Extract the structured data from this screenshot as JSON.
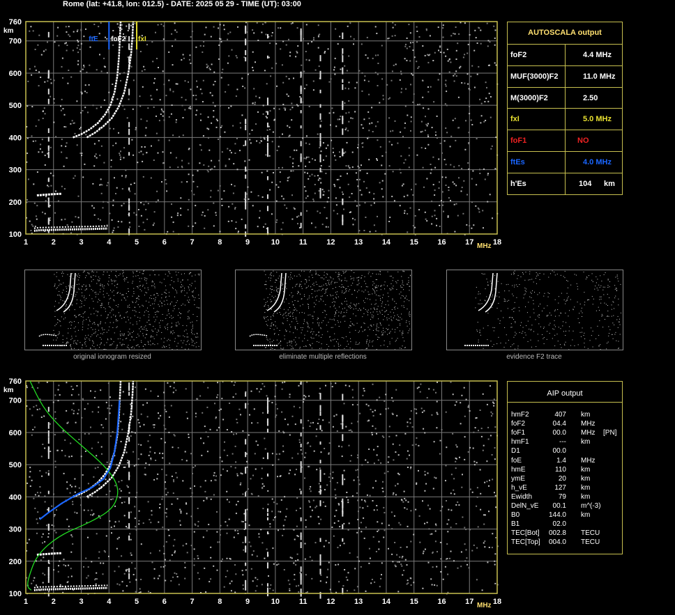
{
  "header": "Rome (lat: +41.8, lon: 012.5) - DATE: 2025 05 29 - TIME (UT): 03:00",
  "colors": {
    "frame": "#c8c050",
    "grid": "#7a7a7a",
    "trace": "#ffffff",
    "profile": "#22dd22",
    "blue": "#1a66ff",
    "yellow": "#e8e030",
    "red": "#ee2222"
  },
  "chart_data": [
    {
      "type": "scatter",
      "name": "ionogram-autoscala",
      "xlabel": "MHz",
      "ylabel": "km",
      "xlim": [
        1,
        18
      ],
      "ylim": [
        100,
        760
      ],
      "xticks": [
        1,
        2,
        3,
        4,
        5,
        6,
        7,
        8,
        9,
        10,
        11,
        12,
        13,
        14,
        15,
        16,
        17,
        18
      ],
      "yticks": [
        100,
        200,
        300,
        400,
        500,
        600,
        700,
        760
      ],
      "grid": true,
      "markers": [
        {
          "label": "ftE",
          "x": 4.0,
          "color": "blue"
        },
        {
          "label": "foF2",
          "x": 4.4,
          "color": "white"
        },
        {
          "label": "fxI",
          "x": 5.0,
          "color": "yellow"
        }
      ],
      "traces": {
        "o_F2": [
          [
            2.7,
            400
          ],
          [
            3.0,
            410
          ],
          [
            3.3,
            425
          ],
          [
            3.6,
            445
          ],
          [
            3.85,
            470
          ],
          [
            4.05,
            500
          ],
          [
            4.2,
            540
          ],
          [
            4.3,
            590
          ],
          [
            4.36,
            650
          ],
          [
            4.4,
            720
          ],
          [
            4.42,
            760
          ]
        ],
        "x_F2": [
          [
            3.2,
            400
          ],
          [
            3.5,
            415
          ],
          [
            3.8,
            435
          ],
          [
            4.1,
            460
          ],
          [
            4.35,
            495
          ],
          [
            4.55,
            540
          ],
          [
            4.7,
            600
          ],
          [
            4.8,
            660
          ],
          [
            4.85,
            720
          ],
          [
            4.87,
            760
          ]
        ],
        "E_layer": [
          [
            1.3,
            110
          ],
          [
            1.5,
            112
          ],
          [
            2.0,
            113
          ],
          [
            2.5,
            114
          ],
          [
            3.0,
            115
          ],
          [
            3.5,
            116
          ],
          [
            3.95,
            117
          ]
        ],
        "Es_second": [
          [
            1.4,
            220
          ],
          [
            1.7,
            222
          ],
          [
            2.0,
            224
          ],
          [
            2.3,
            225
          ]
        ]
      }
    },
    {
      "type": "scatter",
      "name": "ionogram-aip",
      "xlabel": "MHz",
      "ylabel": "km",
      "xlim": [
        1,
        18
      ],
      "ylim": [
        100,
        760
      ],
      "xticks": [
        1,
        2,
        3,
        4,
        5,
        6,
        7,
        8,
        9,
        10,
        11,
        12,
        13,
        14,
        15,
        16,
        17,
        18
      ],
      "yticks": [
        100,
        200,
        300,
        400,
        500,
        600,
        700,
        760
      ],
      "grid": true,
      "profile_curve": [
        [
          1.15,
          760
        ],
        [
          1.6,
          680
        ],
        [
          2.2,
          620
        ],
        [
          3.0,
          560
        ],
        [
          3.8,
          500
        ],
        [
          4.25,
          450
        ],
        [
          4.35,
          407
        ],
        [
          4.1,
          360
        ],
        [
          3.3,
          320
        ],
        [
          2.2,
          280
        ],
        [
          1.4,
          220
        ],
        [
          1.1,
          150
        ],
        [
          1.05,
          120
        ],
        [
          1.2,
          110
        ]
      ],
      "fit_trace": [
        [
          1.5,
          330
        ],
        [
          1.8,
          350
        ],
        [
          2.3,
          380
        ],
        [
          2.9,
          410
        ],
        [
          3.4,
          430
        ],
        [
          3.8,
          455
        ],
        [
          4.05,
          490
        ],
        [
          4.2,
          540
        ],
        [
          4.3,
          600
        ],
        [
          4.35,
          660
        ],
        [
          4.38,
          700
        ]
      ]
    }
  ],
  "autoscala": {
    "title": "AUTOSCALA output",
    "rows": [
      {
        "label": "foF2",
        "value": "4.4 MHz",
        "color": "#ffffff"
      },
      {
        "label": "MUF(3000)F2",
        "value": "11.0 MHz",
        "color": "#ffffff"
      },
      {
        "label": "M(3000)F2",
        "value": "2.50",
        "color": "#ffffff"
      },
      {
        "label": "fxI",
        "value": "5.0 MHz",
        "color": "#e8e030"
      },
      {
        "label": "foF1",
        "value": "NO",
        "color": "#ee2222"
      },
      {
        "label": "ftEs",
        "value": "4.0 MHz",
        "color": "#1a66ff"
      },
      {
        "label": "h'Es",
        "value": "104",
        "unit": "km",
        "color": "#ffffff"
      }
    ]
  },
  "thumbnails": [
    {
      "caption": "original ionogram resized"
    },
    {
      "caption": "eliminate multiple reflections"
    },
    {
      "caption": "evidence F2 trace"
    }
  ],
  "aip": {
    "title": "AIP output",
    "rows": [
      {
        "k": "hmF2",
        "v": "407",
        "u": "km",
        "x": ""
      },
      {
        "k": "foF2",
        "v": "04.4",
        "u": "MHz",
        "x": ""
      },
      {
        "k": "foF1",
        "v": "00.0",
        "u": "MHz",
        "x": "[PN]"
      },
      {
        "k": "hmF1",
        "v": "---",
        "u": "km",
        "x": ""
      },
      {
        "k": "D1",
        "v": "00.0",
        "u": "",
        "x": ""
      },
      {
        "k": "foE",
        "v": "1.4",
        "u": "MHz",
        "x": ""
      },
      {
        "k": "hmE",
        "v": "110",
        "u": "km",
        "x": ""
      },
      {
        "k": "ymE",
        "v": "20",
        "u": "km",
        "x": ""
      },
      {
        "k": "h_vE",
        "v": "127",
        "u": "km",
        "x": ""
      },
      {
        "k": "Ewidth",
        "v": "79",
        "u": "km",
        "x": ""
      },
      {
        "k": "DelN_vE",
        "v": "00.1",
        "u": "m^(-3)",
        "x": ""
      },
      {
        "k": "B0",
        "v": "144.0",
        "u": "km",
        "x": ""
      },
      {
        "k": "B1",
        "v": "02.0",
        "u": "",
        "x": ""
      },
      {
        "k": "TEC[Bot]",
        "v": "002.8",
        "u": "TECU",
        "x": ""
      },
      {
        "k": "TEC[Top]",
        "v": "004.0",
        "u": "TECU",
        "x": ""
      }
    ]
  }
}
